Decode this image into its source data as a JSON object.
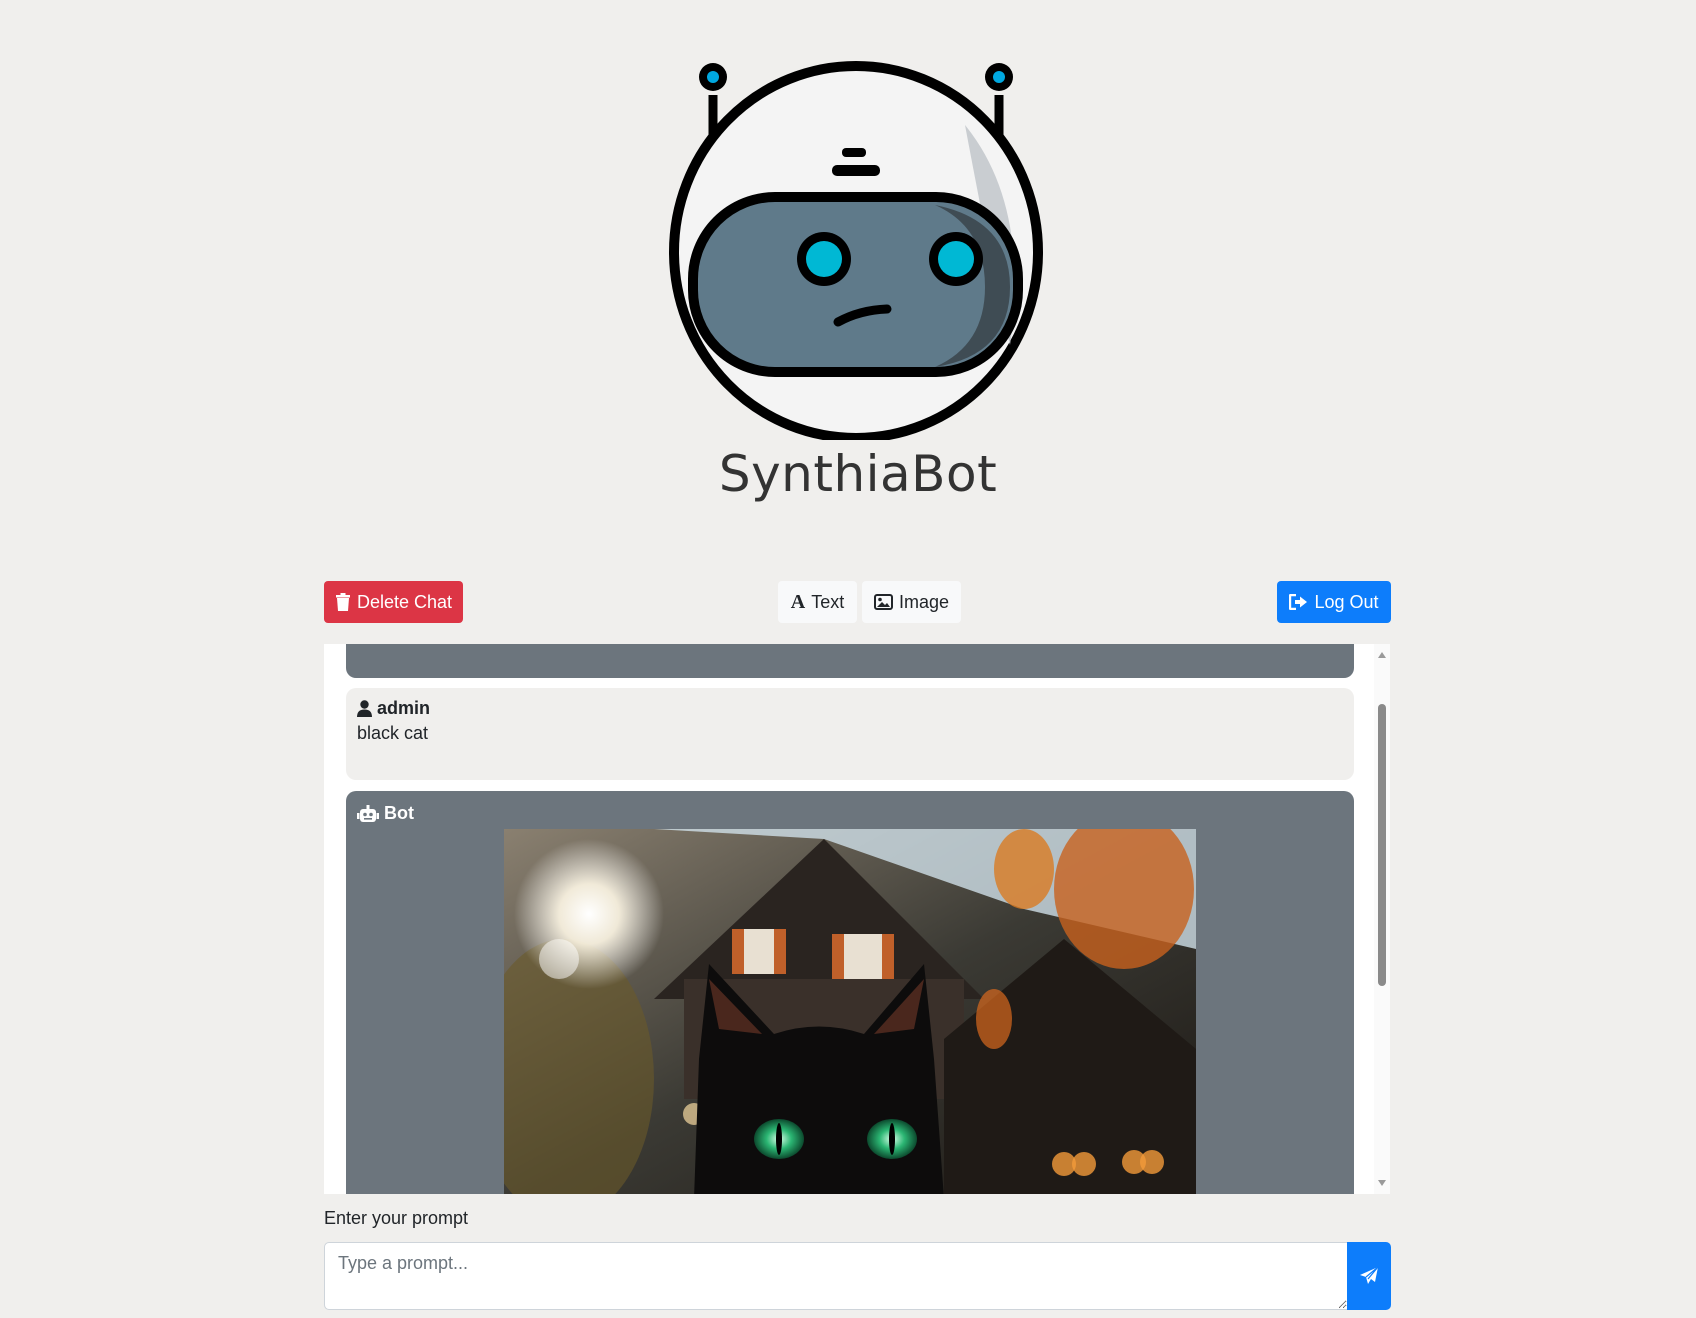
{
  "app": {
    "title": "SynthiaBot"
  },
  "toolbar": {
    "delete_label": "Delete Chat",
    "text_label": "Text",
    "image_label": "Image",
    "logout_label": "Log Out"
  },
  "messages": [
    {
      "role": "bot",
      "text": ""
    },
    {
      "role": "user",
      "author": "admin",
      "text": "black cat"
    },
    {
      "role": "bot",
      "author": "Bot",
      "content": "image"
    }
  ],
  "prompt": {
    "label": "Enter your prompt",
    "placeholder": "Type a prompt..."
  },
  "colors": {
    "danger": "#dc3545",
    "primary": "#0d7dfb",
    "bot_bg": "#6c757d",
    "accent_cyan": "#00b4d8"
  },
  "icons": {
    "delete": "trash-icon",
    "text": "font-icon",
    "image": "image-icon",
    "logout": "sign-out-icon",
    "user": "user-icon",
    "bot": "robot-icon",
    "send": "paper-plane-icon"
  }
}
